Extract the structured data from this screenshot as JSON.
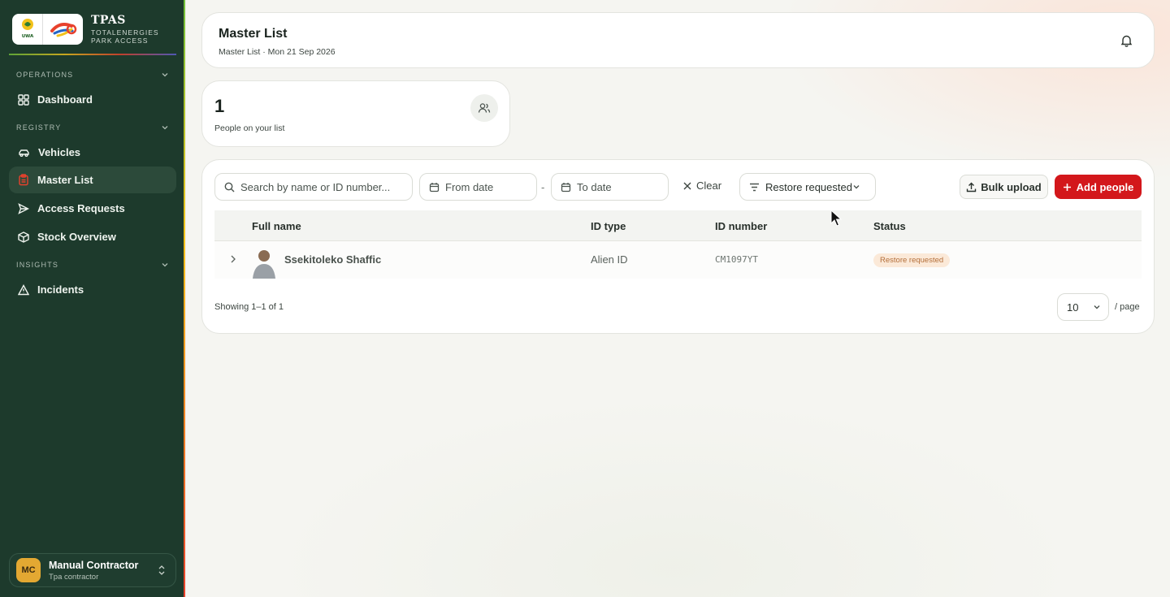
{
  "brand": {
    "title": "TPAS",
    "subtitle_line1": "TOTALENERGIES",
    "subtitle_line2": "PARK ACCESS",
    "logo_uwa_text": "UWA"
  },
  "sidebar": {
    "sections": [
      {
        "label": "OPERATIONS",
        "items": [
          {
            "label": "Dashboard",
            "icon": "grid-icon"
          }
        ]
      },
      {
        "label": "REGISTRY",
        "items": [
          {
            "label": "Vehicles",
            "icon": "car-icon"
          },
          {
            "label": "Master List",
            "icon": "clipboard-icon",
            "active": true
          },
          {
            "label": "Access Requests",
            "icon": "send-icon"
          },
          {
            "label": "Stock Overview",
            "icon": "box-icon"
          }
        ]
      },
      {
        "label": "INSIGHTS",
        "items": [
          {
            "label": "Incidents",
            "icon": "alert-triangle-icon"
          }
        ]
      }
    ]
  },
  "user": {
    "initials": "MC",
    "name": "Manual Contractor",
    "role": "Tpa contractor"
  },
  "header": {
    "title": "Master List",
    "subtitle": "Master List · Mon 21 Sep 2026"
  },
  "stat": {
    "value": "1",
    "label": "People on your list"
  },
  "toolbar": {
    "search_placeholder": "Search by name or ID number...",
    "from_placeholder": "From date",
    "separator": "-",
    "to_placeholder": "To date",
    "clear_label": "Clear",
    "filter_value": "Restore requested",
    "bulk_label": "Bulk upload",
    "add_label": "Add people"
  },
  "table": {
    "columns": [
      "Full name",
      "ID type",
      "ID number",
      "Status"
    ],
    "rows": [
      {
        "name": "Ssekitoleko Shaffic",
        "id_type": "Alien ID",
        "id_number": "CM1097YT",
        "status": "Restore requested"
      }
    ]
  },
  "pagination": {
    "showing": "Showing 1–1 of 1",
    "page_size": "10",
    "per_page_label": "/ page"
  },
  "colors": {
    "sidebar_bg": "#1d3a2c",
    "active_item_bg": "#2c4a3a",
    "primary_red": "#d3171b",
    "badge_bg": "#fbe9d8",
    "badge_text": "#b46f3a",
    "avatar_bg": "#e3a832"
  }
}
